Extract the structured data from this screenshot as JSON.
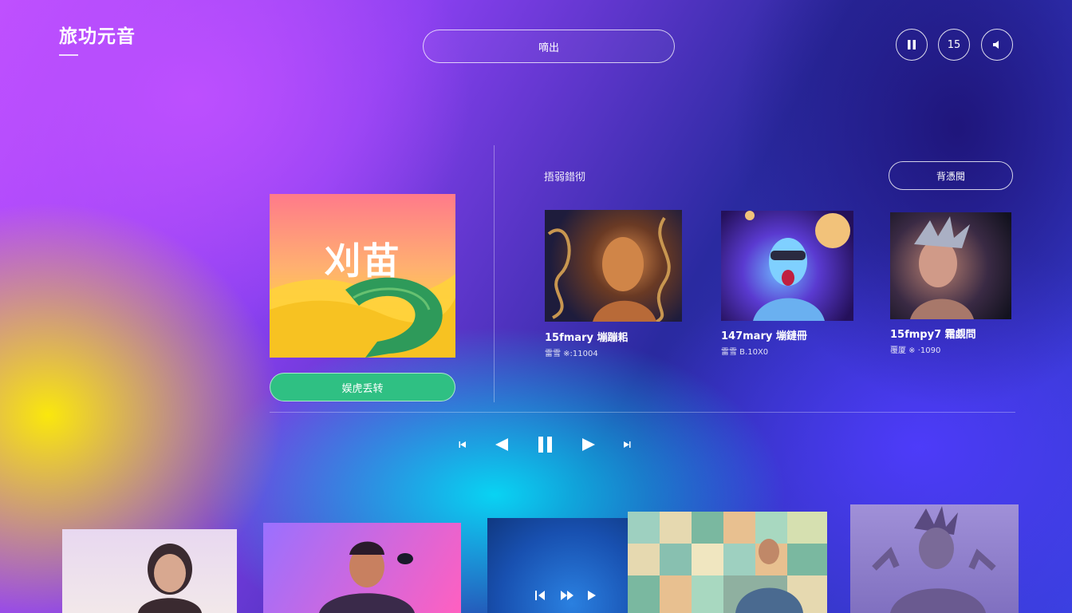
{
  "header": {
    "app_title": "旅功元音",
    "search_label": "嘀出",
    "controls": [
      {
        "label": "",
        "icon": "pause-icon"
      },
      {
        "label": "15",
        "icon": "skip-15-icon"
      },
      {
        "label": "",
        "icon": "volume-icon"
      }
    ]
  },
  "featured": {
    "art_title": "刈苗",
    "button_label": "娱虎丢转"
  },
  "recommended": {
    "section_label": "捂弱錯彻",
    "more_label": "背憑閱",
    "cards": [
      {
        "title": "15fmary 塴蹦耜",
        "subtitle": "雷雪 ※:11004"
      },
      {
        "title": "147mary 塴鏈冊",
        "subtitle": "雷雪 Β.10X0"
      },
      {
        "title": "15fmpy7 霜覷問",
        "subtitle": "覆厦 ※ ·1090"
      }
    ]
  },
  "player": {
    "controls": [
      "skip-back-icon",
      "previous-icon",
      "pause-icon",
      "play-icon",
      "skip-forward-icon"
    ]
  },
  "colors": {
    "accent_green": "#2fc083"
  }
}
